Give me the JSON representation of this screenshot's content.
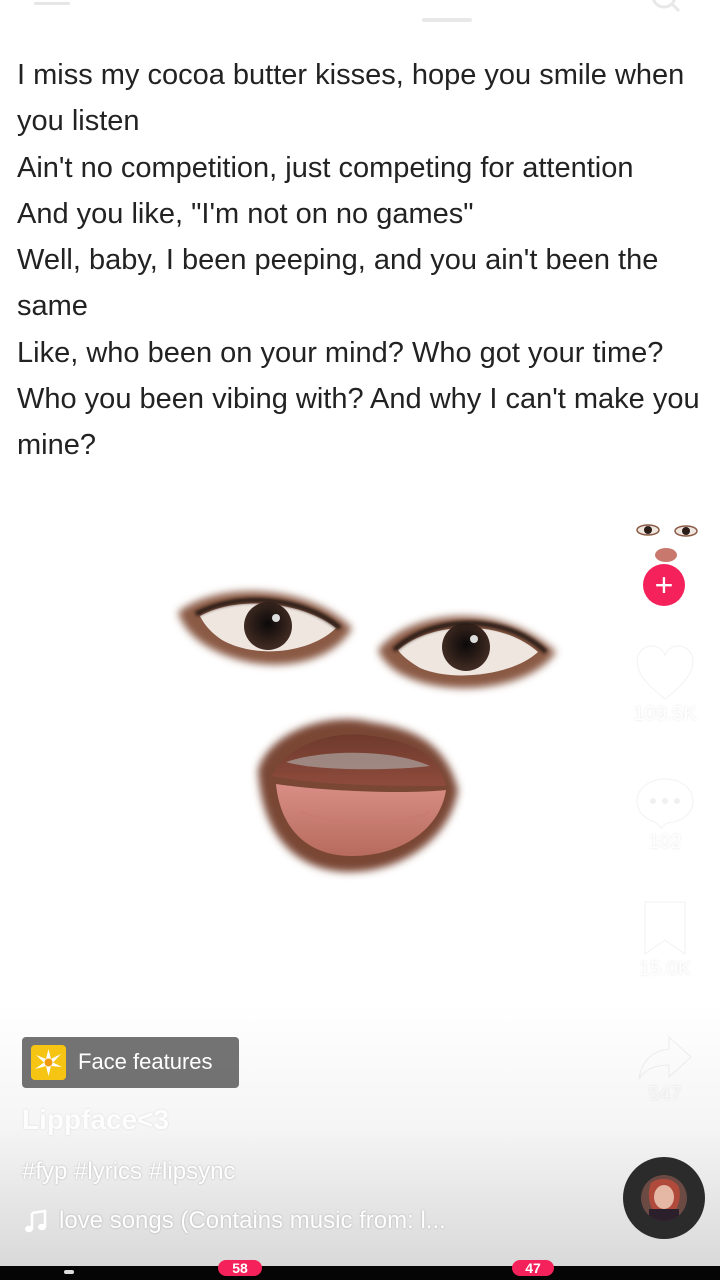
{
  "lyrics": [
    "I miss my cocoa butter kisses, hope you smile when you listen",
    "Ain't no competition, just competing for attention",
    "And you like, \"I'm not on no games\"",
    "Well, baby, I been peeping, and you ain't been the same",
    "Like, who been on your mind? Who got your time?",
    "Who you been vibing with? And why I can't make you mine?"
  ],
  "actions": {
    "likes": "109.5K",
    "comments": "102",
    "bookmarks": "15.0K",
    "shares": "547"
  },
  "follow": {
    "label": "+"
  },
  "effect": {
    "label": "Face features"
  },
  "post": {
    "username": "Lippface<3",
    "hashtags": "#fyp #lyrics #lipsync",
    "music": "love songs (Contains music from: l..."
  },
  "nav": {
    "badge_left": "58",
    "badge_right": "47"
  },
  "colors": {
    "accent": "#f4215a",
    "effect_icon": "#f6c514"
  },
  "icons": [
    "menu-icon",
    "search-icon",
    "heart-icon",
    "comment-icon",
    "bookmark-icon",
    "share-icon",
    "music-note-icon",
    "face-effect-icon"
  ]
}
